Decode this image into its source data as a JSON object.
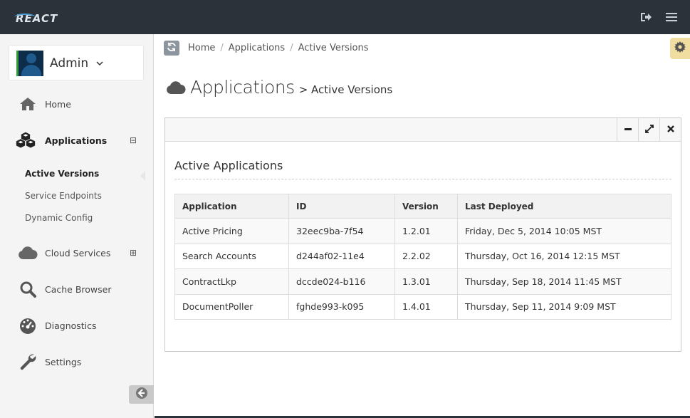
{
  "app": {
    "logo_text": "REACT"
  },
  "colors": {
    "topbar": "#2b323a",
    "accent": "#4da0d8",
    "settings_tab": "#f0dda0",
    "avatar_status": "#2e9d3a"
  },
  "user": {
    "name": "Admin"
  },
  "sidebar": {
    "items": [
      {
        "label": "Home",
        "icon": "home-icon"
      },
      {
        "label": "Applications",
        "icon": "cubes-icon",
        "toggle": "⊟"
      },
      {
        "label": "Cloud Services",
        "icon": "cloud-icon",
        "toggle": "⊞"
      },
      {
        "label": "Cache Browser",
        "icon": "search-icon"
      },
      {
        "label": "Diagnostics",
        "icon": "dashboard-icon"
      },
      {
        "label": "Settings",
        "icon": "wrench-icon"
      }
    ],
    "subitems": [
      {
        "label": "Active Versions"
      },
      {
        "label": "Service Endpoints"
      },
      {
        "label": "Dynamic Config"
      }
    ]
  },
  "breadcrumb": [
    "Home",
    "Applications",
    "Active Versions"
  ],
  "page": {
    "title": "Applications",
    "subtitle": "> Active Versions"
  },
  "widget": {
    "title": "Active Applications",
    "columns": [
      "Application",
      "ID",
      "Version",
      "Last Deployed"
    ],
    "rows": [
      [
        "Active Pricing",
        "32eec9ba-7f54",
        "1.2.01",
        "Friday, Dec 5, 2014 10:05 MST"
      ],
      [
        "Search Accounts",
        "d244af02-11e4",
        "2.2.02",
        "Thursday, Oct 16, 2014 12:15 MST"
      ],
      [
        "ContractLkp",
        "dccde024-b116",
        "1.3.01",
        "Thursday, Sep 18, 2014 11:45 MST"
      ],
      [
        "DocumentPoller",
        "fghde993-k095",
        "1.4.01",
        "Thursday, Sep 11, 2014 9:09 MST"
      ]
    ]
  }
}
